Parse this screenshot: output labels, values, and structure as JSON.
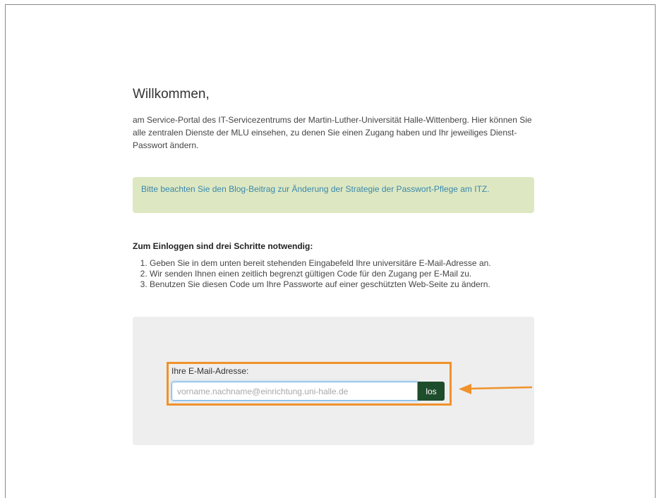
{
  "welcome": {
    "title": "Willkommen,",
    "intro": "am Service-Portal des IT-Servicezentrums der Martin-Luther-Universität Halle-Wittenberg. Hier können Sie alle zentralen Dienste der MLU einsehen, zu denen Sie einen Zugang haben und Ihr jeweiliges Dienst-Passwort ändern."
  },
  "notice": {
    "text": "Bitte beachten Sie den Blog-Beitrag zur Änderung der Strategie der Passwort-Pflege am ITZ."
  },
  "steps": {
    "title": "Zum Einloggen sind drei Schritte notwendig:",
    "items": [
      "Geben Sie in dem unten bereit stehenden Eingabefeld Ihre universitäre E-Mail-Adresse an.",
      "Wir senden Ihnen einen zeitlich begrenzt gültigen Code für den Zugang per E-Mail zu.",
      "Benutzen Sie diesen Code um Ihre Passworte auf einer geschützten Web-Seite zu ändern."
    ]
  },
  "login": {
    "label": "Ihre E-Mail-Adresse:",
    "placeholder": "vorname.nachname@einrichtung.uni-halle.de",
    "value": "",
    "button_label": "los"
  },
  "colors": {
    "highlight": "#f0922b",
    "button": "#1e4d2b",
    "notice_bg": "#dde8c2",
    "notice_text": "#3a87ad"
  }
}
